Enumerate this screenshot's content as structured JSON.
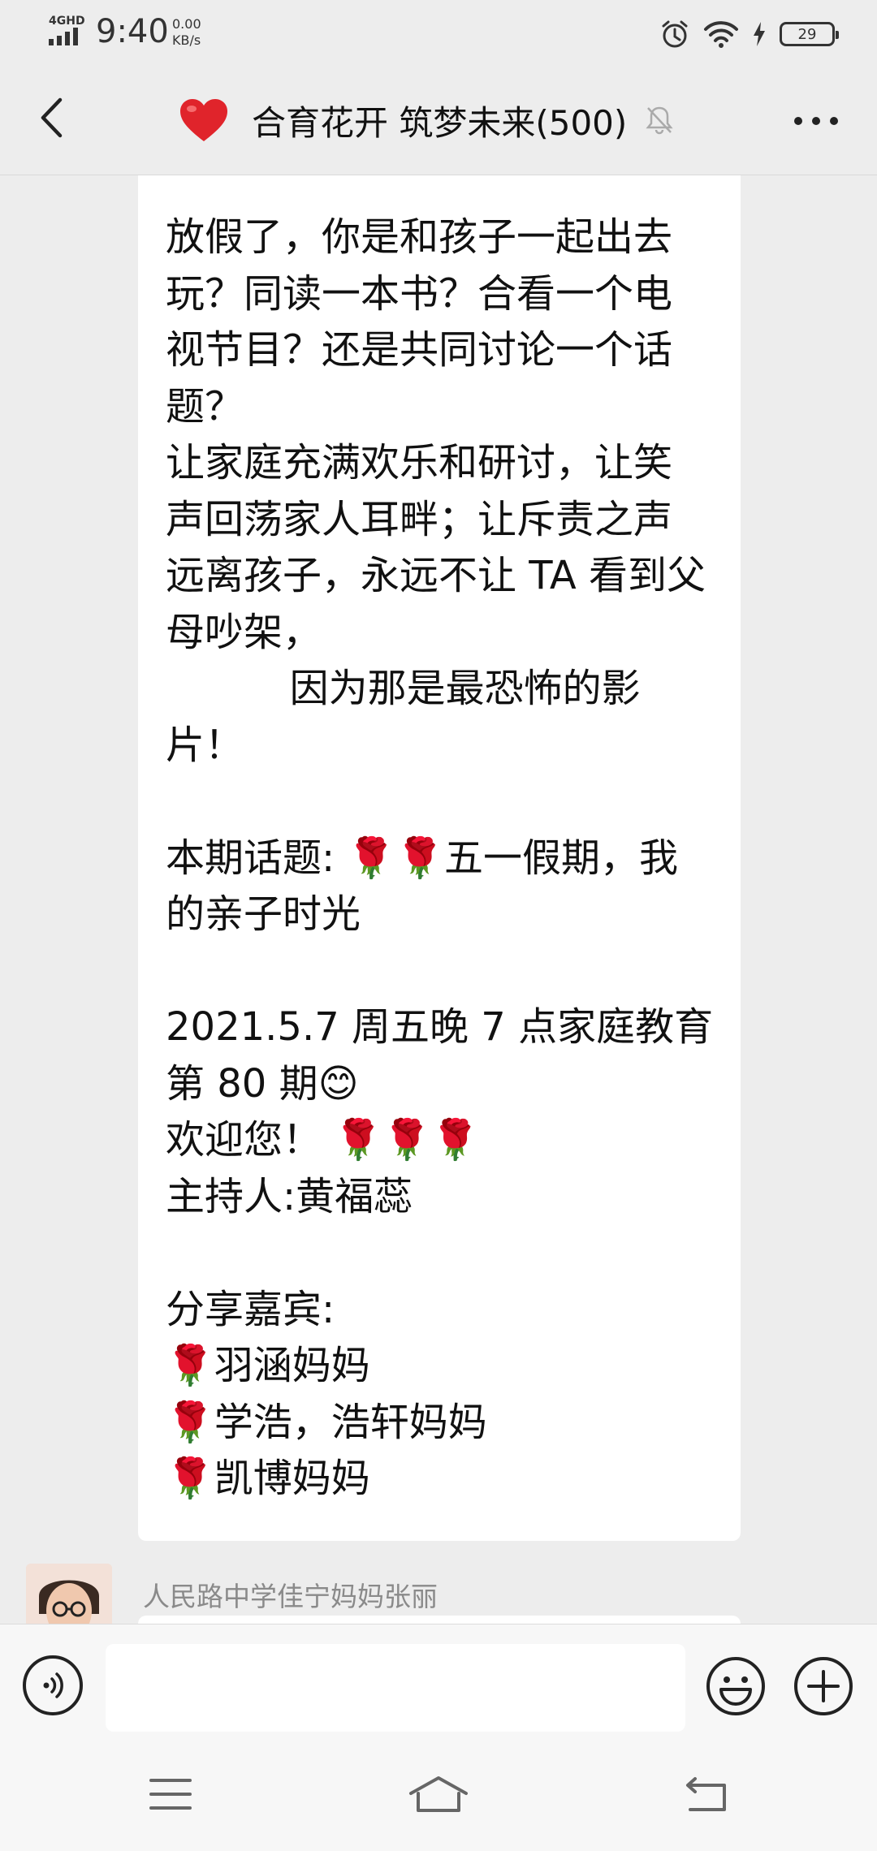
{
  "status_bar": {
    "network": "4GHD",
    "time": "9:40",
    "speed_value": "0.00",
    "speed_unit": "KB/s",
    "battery": "29"
  },
  "header": {
    "title": "合育花开 筑梦未来(500)",
    "icons": {
      "back": "chevron-left-icon",
      "title_emoji": "heart-icon",
      "mute": "muted-bell-icon",
      "more": "more-dots-icon"
    }
  },
  "message": {
    "lines": [
      "放假了，你是和孩子一起出去",
      "玩？同读一本书？合看一个电",
      "视节目？还是共同讨论一个话",
      "题？",
      "让家庭充满欢乐和研讨，让笑",
      "声回荡家人耳畔；让斥责之声",
      "远离孩子，永远不让 TA 看到父",
      "母吵架，",
      "          因为那是最恐怖的影",
      "片！",
      "",
      "本期话题: 🌹🌹五一假期，我",
      "的亲子时光",
      "",
      "2021.5.7 周五晚 7 点家庭教育",
      "第 80 期😊",
      "欢迎您！ 🌹🌹🌹",
      "主持人:黄福蕊",
      "",
      "分享嘉宾:",
      "🌹羽涵妈妈",
      "🌹学浩，浩轩妈妈",
      "🌹凯博妈妈"
    ]
  },
  "next_message": {
    "sender": "人民路中学佳宁妈妈张丽"
  },
  "input_bar": {
    "placeholder": "",
    "icons": {
      "voice": "voice-icon",
      "emoji": "emoji-icon",
      "more": "plus-icon"
    }
  },
  "nav_bar": {
    "icons": [
      "menu-icon",
      "home-icon",
      "back-nav-icon"
    ]
  },
  "colors": {
    "background": "#ededed",
    "bubble": "#ffffff",
    "text": "#111111",
    "sender_name": "#8a8a8a"
  }
}
